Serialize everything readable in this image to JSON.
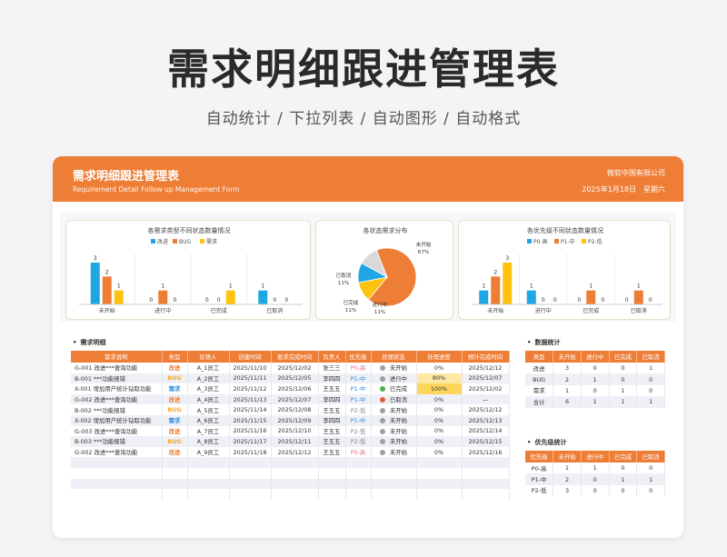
{
  "hero": {
    "title": "需求明细跟进管理表",
    "subtitle": "自动统计 / 下拉列表 / 自动图形 / 自动格式"
  },
  "header": {
    "title": "需求明细跟进管理表",
    "subtitle": "Requirement Detail Follow up Management Form",
    "company": "微软中国有限公司",
    "date": "2025年1月18日",
    "weekday": "星期六"
  },
  "colors": {
    "accent": "#ee7d35",
    "blue": "#1ea7e4",
    "orange": "#ee7d35",
    "yellow": "#ffc20e",
    "gray": "#d9d9d9"
  },
  "charts": [
    {
      "type": "bar",
      "title": "各需求类型不同状态数量情况",
      "legend": [
        "改进",
        "BUG",
        "需求"
      ],
      "categories": [
        "未开始",
        "进行中",
        "已完成",
        "已取消"
      ],
      "series": [
        {
          "name": "改进",
          "values": [
            3,
            0,
            0,
            1
          ]
        },
        {
          "name": "BUG",
          "values": [
            2,
            1,
            0,
            0
          ]
        },
        {
          "name": "需求",
          "values": [
            1,
            0,
            1,
            0
          ]
        }
      ]
    },
    {
      "type": "pie",
      "title": "各状态需求分布",
      "slices": [
        {
          "name": "未开始",
          "value": 67,
          "label": "未开始",
          "pct": "67%"
        },
        {
          "name": "进行中",
          "value": 11,
          "label": "进行中",
          "pct": "11%"
        },
        {
          "name": "已完成",
          "value": 11,
          "label": "已完成",
          "pct": "11%"
        },
        {
          "name": "已取消",
          "value": 11,
          "label": "已取消",
          "pct": "11%"
        }
      ]
    },
    {
      "type": "bar",
      "title": "各优先级不同状态数量情况",
      "legend": [
        "P0-高",
        "P1-中",
        "P2-低"
      ],
      "categories": [
        "未开始",
        "进行中",
        "已完成",
        "已取消"
      ],
      "series": [
        {
          "name": "P0-高",
          "values": [
            1,
            1,
            0,
            0
          ]
        },
        {
          "name": "P1-中",
          "values": [
            2,
            0,
            1,
            1
          ]
        },
        {
          "name": "P2-低",
          "values": [
            3,
            0,
            0,
            0
          ]
        }
      ]
    }
  ],
  "detail": {
    "label": "需求明细",
    "columns": [
      "需求说明",
      "类型",
      "反馈人",
      "创建时间",
      "要求完成时间",
      "负责人",
      "优先级",
      "处理状态",
      "处理进度",
      "预计完成时间"
    ],
    "rows": [
      [
        "G-001 改进***查询功能",
        "改进",
        "A_1员工",
        "2025/11/10",
        "2025/12/02",
        "张三三",
        "P0-高",
        "未开始",
        "0%",
        "2025/12/12"
      ],
      [
        "B-001 ***功能报错",
        "BUG",
        "A_2员工",
        "2025/11/11",
        "2025/12/05",
        "李四四",
        "P1-中",
        "进行中",
        "80%",
        "2025/12/07"
      ],
      [
        "X-001 增加用户统计钻取功能",
        "需求",
        "A_3员工",
        "2025/11/12",
        "2025/12/06",
        "王五五",
        "P1-中",
        "已完成",
        "100%",
        "2025/12/02"
      ],
      [
        "G-002 改进***查询功能",
        "改进",
        "A_4员工",
        "2025/11/13",
        "2025/12/07",
        "李四四",
        "P1-中",
        "已取消",
        "0%",
        "—"
      ],
      [
        "B-002 ***功能报错",
        "BUG",
        "A_5员工",
        "2025/11/14",
        "2025/12/08",
        "王五五",
        "P2-低",
        "未开始",
        "0%",
        "2025/12/12"
      ],
      [
        "X-002 增加用户统计钻取功能",
        "需求",
        "A_6员工",
        "2025/11/15",
        "2025/12/09",
        "李四四",
        "P1-中",
        "未开始",
        "0%",
        "2025/12/13"
      ],
      [
        "G-003 改进***查询功能",
        "改进",
        "A_7员工",
        "2025/11/16",
        "2025/12/10",
        "王五五",
        "P2-低",
        "未开始",
        "0%",
        "2025/12/14"
      ],
      [
        "B-003 ***功能报错",
        "BUG",
        "A_8员工",
        "2025/11/17",
        "2025/12/11",
        "王五五",
        "P2-低",
        "未开始",
        "0%",
        "2025/12/15"
      ],
      [
        "G-002 改进***查询功能",
        "改进",
        "A_9员工",
        "2025/11/18",
        "2025/12/12",
        "王五五",
        "P0-高",
        "未开始",
        "0%",
        "2025/12/16"
      ]
    ]
  },
  "stats1": {
    "label": "数据统计",
    "columns": [
      "类型",
      "未开始",
      "进行中",
      "已完成",
      "已取消"
    ],
    "rows": [
      [
        "改进",
        "3",
        "0",
        "0",
        "1"
      ],
      [
        "BUG",
        "2",
        "1",
        "0",
        "0"
      ],
      [
        "需求",
        "1",
        "0",
        "1",
        "0"
      ],
      [
        "合计",
        "6",
        "1",
        "1",
        "1"
      ]
    ]
  },
  "stats2": {
    "label": "优先级统计",
    "columns": [
      "优先级",
      "未开始",
      "进行中",
      "已完成",
      "已取消"
    ],
    "rows": [
      [
        "P0-高",
        "1",
        "1",
        "0",
        "0"
      ],
      [
        "P1-中",
        "2",
        "0",
        "1",
        "1"
      ],
      [
        "P2-低",
        "3",
        "0",
        "0",
        "0"
      ]
    ]
  }
}
